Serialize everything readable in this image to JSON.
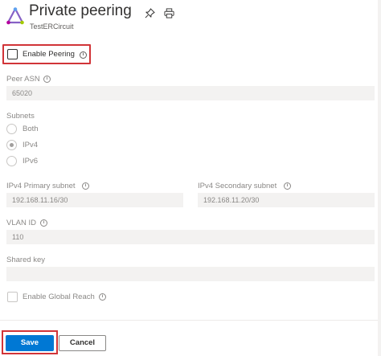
{
  "header": {
    "title": "Private peering",
    "subtitle": "TestERCircuit",
    "logo_icon": "expressroute-triangle-icon",
    "pin_icon": "pin-icon",
    "print_icon": "print-icon"
  },
  "form": {
    "enable_peering": {
      "label": "Enable Peering",
      "checked": false
    },
    "peer_asn": {
      "label": "Peer ASN",
      "value": "65020"
    },
    "subnets": {
      "label": "Subnets",
      "options": [
        "Both",
        "IPv4",
        "IPv6"
      ],
      "selected": "IPv4"
    },
    "ipv4_primary": {
      "label": "IPv4 Primary subnet",
      "value": "192.168.11.16/30"
    },
    "ipv4_secondary": {
      "label": "IPv4 Secondary subnet",
      "value": "192.168.11.20/30"
    },
    "vlan_id": {
      "label": "VLAN ID",
      "value": "110"
    },
    "shared_key": {
      "label": "Shared key",
      "value": ""
    },
    "enable_global_reach": {
      "label": "Enable Global Reach",
      "checked": false
    }
  },
  "actions": {
    "save_label": "Save",
    "cancel_label": "Cancel"
  },
  "colors": {
    "accent": "#0078d4",
    "highlight": "#d13438",
    "logo_stroke": "#8661c5"
  },
  "info_glyph": "i"
}
